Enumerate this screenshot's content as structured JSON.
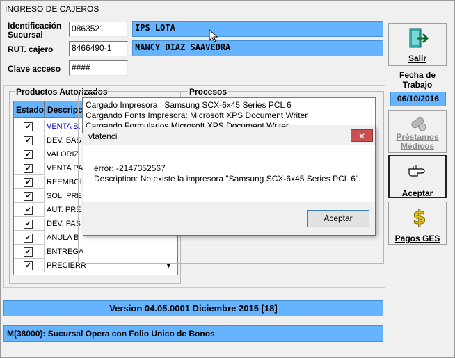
{
  "window": {
    "title": "INGRESO DE CAJEROS"
  },
  "form": {
    "sucursal_label": "Identificación Sucursal",
    "sucursal_value": "0863521",
    "sucursal_name": "IPS LOTA",
    "rut_label": "RUT. cajero",
    "rut_value": "8466490-1",
    "cajero_name": "NANCY  DIAZ  SAAVEDRA",
    "clave_label": "Clave acceso",
    "clave_value": "####"
  },
  "sidebar": {
    "salir_label": "Salir",
    "fecha_label": "Fecha de Trabajo",
    "fecha_value": "06/10/2016",
    "prestamos_label": "Préstamos Médicos",
    "aceptar_label": "Aceptar",
    "pagos_label": "Pagos GES"
  },
  "productos": {
    "group_label": "Productos Autorizados",
    "col_estado": "Estado",
    "col_descripcion": "Descripc",
    "rows": [
      {
        "checked": true,
        "label": "VENTA B."
      },
      {
        "checked": true,
        "label": "DEV. BAS"
      },
      {
        "checked": true,
        "label": "VALORIZ"
      },
      {
        "checked": true,
        "label": "VENTA PA"
      },
      {
        "checked": true,
        "label": "REEMBOI"
      },
      {
        "checked": true,
        "label": "SOL. PRE"
      },
      {
        "checked": true,
        "label": "AUT. PRE"
      },
      {
        "checked": true,
        "label": "DEV. PAS"
      },
      {
        "checked": true,
        "label": "ANULA B"
      },
      {
        "checked": true,
        "label": "ENTREGA"
      },
      {
        "checked": true,
        "label": "PRECIERR"
      }
    ]
  },
  "log": {
    "group_label": "Procesos",
    "lines": [
      "Cargado Impresora : Samsung SCX-6x45 Series PCL 6",
      "Cargando Fonts Impresora: Microsoft XPS Document Writer",
      "Cargando Formularios Microsoft XPS Document Writer"
    ]
  },
  "version": "Version 04.05.0001 Diciembre 2015 [18]",
  "status_message": "M(38000): Sucursal Opera con Folio Unico de Bonos",
  "dialog": {
    "title": "vtatenci",
    "error_line": "error: -2147352567",
    "description_line": "Description: No existe la impresora \"Samsung SCX-6x45 Series PCL 6\".",
    "ok_label": "Aceptar",
    "close_glyph": "✕"
  },
  "colors": {
    "accent_blue": "#66b3ff",
    "close_red": "#c75050"
  }
}
